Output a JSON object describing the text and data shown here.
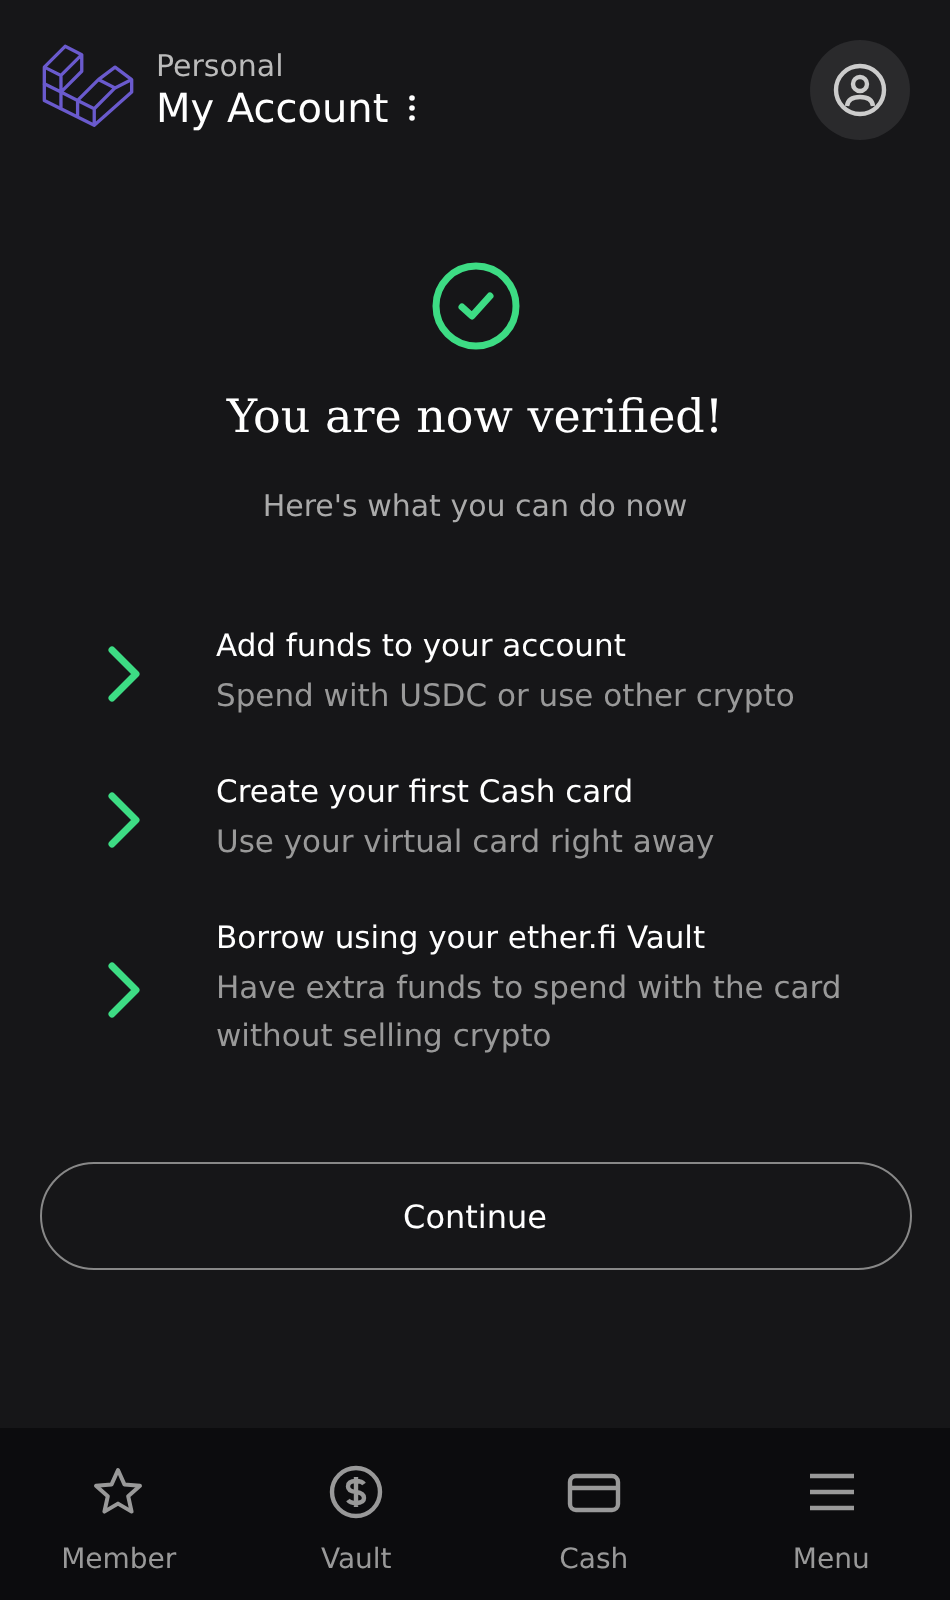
{
  "header": {
    "subtitle": "Personal",
    "title": "My Account"
  },
  "status": {
    "title": "You are now verified!",
    "subtitle": "Here's what you can do now"
  },
  "steps": [
    {
      "title": "Add funds to your account",
      "description": "Spend with USDC or use other crypto"
    },
    {
      "title": "Create your first Cash card",
      "description": "Use your virtual card right away"
    },
    {
      "title": "Borrow using your ether.fi Vault",
      "description": "Have extra funds to spend with the card without selling crypto"
    }
  ],
  "continue_button": "Continue",
  "bottom_nav": [
    {
      "label": "Member",
      "kind": "star"
    },
    {
      "label": "Vault",
      "kind": "dollar"
    },
    {
      "label": "Cash",
      "kind": "card"
    },
    {
      "label": "Menu",
      "kind": "menu"
    }
  ]
}
